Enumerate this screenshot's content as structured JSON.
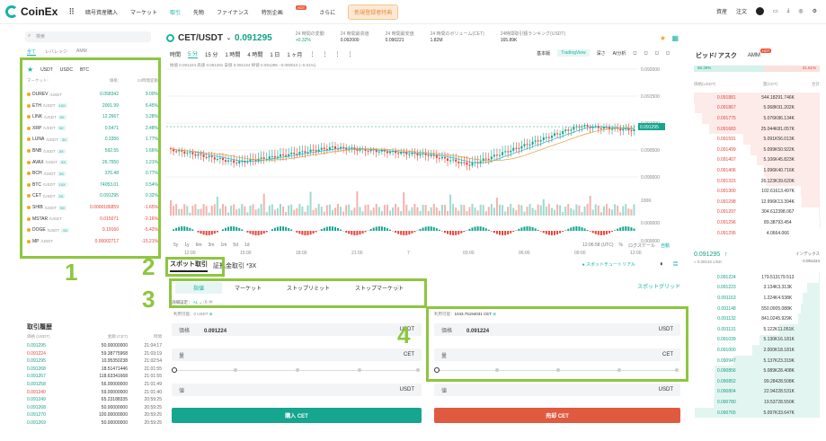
{
  "nav": {
    "logo": "CoinEx",
    "items": [
      "暗号資産購入",
      "マーケット",
      "取引",
      "先物",
      "ファイナンス",
      "特別企画",
      "さらに"
    ],
    "hot": "HOT",
    "promo": "新規登録者特典",
    "right": [
      "資産",
      "注文"
    ]
  },
  "left": {
    "search": "検索",
    "tabs": [
      "全て",
      "レバレッジ",
      "AMM"
    ],
    "quotes": [
      "USDT",
      "USDC",
      "BTC"
    ],
    "head": {
      "market": "マーケット:",
      "price": "価格:",
      "change": "24時間変動"
    },
    "rows": [
      {
        "name": "DUREV",
        "quote": "/USDT",
        "lev": "",
        "price": "0.058342",
        "chg": "9.00%",
        "up": true
      },
      {
        "name": "ETH",
        "quote": "/USDT",
        "lev": "10X",
        "price": "2001.99",
        "chg": "6.45%",
        "up": true
      },
      {
        "name": "LINK",
        "quote": "/USDT",
        "lev": "5X",
        "price": "12.2667",
        "chg": "3.28%",
        "up": true
      },
      {
        "name": "XRP",
        "quote": "/USDT",
        "lev": "5X",
        "price": "0.5471",
        "chg": "2.48%",
        "up": true
      },
      {
        "name": "LUNA",
        "quote": "/USDT",
        "lev": "3X",
        "price": "0.3356",
        "chg": "1.77%",
        "up": true
      },
      {
        "name": "BNB",
        "quote": "/USDT",
        "lev": "5X",
        "price": "592.55",
        "chg": "1.66%",
        "up": true
      },
      {
        "name": "AVAX",
        "quote": "/USDT",
        "lev": "5X",
        "price": "26.7550",
        "chg": "1.21%",
        "up": true
      },
      {
        "name": "BCH",
        "quote": "/USDT",
        "lev": "5X",
        "price": "376.48",
        "chg": "0.77%",
        "up": true
      },
      {
        "name": "BTC",
        "quote": "/USDT",
        "lev": "10X",
        "price": "74053.01",
        "chg": "0.54%",
        "up": true
      },
      {
        "name": "CET",
        "quote": "/USDT",
        "lev": "3X",
        "price": "0.091295",
        "chg": "0.32%",
        "up": true
      },
      {
        "name": "SHIB",
        "quote": "/USDT",
        "lev": "5X",
        "price": "0.0000186859",
        "chg": "-1.65%",
        "up": false
      },
      {
        "name": "MSTAR",
        "quote": "/USDT",
        "lev": "",
        "price": "0.015071",
        "chg": "-2.16%",
        "up": false
      },
      {
        "name": "DOGE",
        "quote": "/USDT",
        "lev": "5X",
        "price": "0.19160",
        "chg": "-5.42%",
        "up": false
      },
      {
        "name": "MP",
        "quote": "/USDT",
        "lev": "",
        "price": "0.00002717",
        "chg": "-15.21%",
        "up": false
      }
    ],
    "history_title": "取引履歴",
    "hist_head": [
      "価格 (USDT)",
      "金額 (CET)",
      "時間"
    ],
    "history": [
      {
        "p": "0.091295",
        "a": "50.00000000",
        "t": "21:04:17",
        "up": true
      },
      {
        "p": "0.091224",
        "a": "59.38775968",
        "t": "21:03:19",
        "up": false
      },
      {
        "p": "0.091295",
        "a": "10.95350238",
        "t": "21:02:54",
        "up": true
      },
      {
        "p": "0.091268",
        "a": "18.51471446",
        "t": "21:01:55",
        "up": true
      },
      {
        "p": "0.091267",
        "a": "118.63341668",
        "t": "21:01:55",
        "up": true
      },
      {
        "p": "0.091258",
        "a": "56.00000000",
        "t": "21:01:49",
        "up": true
      },
      {
        "p": "0.091240",
        "a": "59.00000000",
        "t": "21:01:40",
        "up": false
      },
      {
        "p": "0.091249",
        "a": "65.23188335",
        "t": "20:59:25",
        "up": true
      },
      {
        "p": "0.091268",
        "a": "50.00000000",
        "t": "20:59:25",
        "up": true
      },
      {
        "p": "0.091270",
        "a": "100.00000000",
        "t": "20:59:25",
        "up": true
      },
      {
        "p": "0.091269",
        "a": "50.00000000",
        "t": "20:59:25",
        "up": true
      }
    ]
  },
  "ticker": {
    "pair": "CET/USDT",
    "price": "0.091295",
    "stats": [
      {
        "l": "24 時間の変動",
        "v": "+0.32%"
      },
      {
        "l": "24 時間最高値",
        "v": "0.092000"
      },
      {
        "l": "24 時間最安値",
        "v": "0.090221"
      },
      {
        "l": "24 時間のボリューム(CET)",
        "v": "1.82M"
      },
      {
        "l": "24時間取引額ランキング(USDT)",
        "v": "165.89K"
      }
    ]
  },
  "chart": {
    "tools": [
      "時間",
      "5 分",
      "15 分",
      "1 時間",
      "4 時間",
      "1 日",
      "1 ヶ月"
    ],
    "right": [
      "基本版",
      "TradingView",
      "深さ",
      "AI分析"
    ],
    "ohlc": "始値 0.091224  高値 0.091291  安値 0.091224  終値 0.091285  −0.000010 (−0.01%)",
    "yticks": [
      "0.092000",
      "0.091500",
      "0.091000",
      "0.090500",
      "0.090000"
    ],
    "vticks": [
      "100K",
      "0.000000",
      "0.000000"
    ],
    "xticks": [
      "12:00",
      "15:00",
      "18:00",
      "21:00",
      "7",
      "03:00",
      "06:00",
      "09:00",
      "12:00"
    ],
    "last": "0.091295",
    "frames": [
      "5y",
      "1y",
      "6m",
      "3m",
      "1m",
      "5d",
      "1d"
    ],
    "footer": [
      "12:06:58 (UTC)",
      "%",
      "ログスケール",
      "自動"
    ]
  },
  "trade": {
    "tabs": [
      "スポット取引",
      "証拠金取引 *3X"
    ],
    "tutorial": "スポットチュートリアル",
    "order_tabs": [
      "指値",
      "マーケット",
      "ストップリミット",
      "ストップマーケット"
    ],
    "grid": "スポットグリッド",
    "setting": "詳細設定：",
    "setting_val": "AL",
    "buy": {
      "avail_label": "利用可能：",
      "avail": "0 USDT",
      "price_label": "価格",
      "price": "0.091224",
      "unit": "USDT",
      "amount_label": "量",
      "amount_unit": "CET",
      "total_label": "値",
      "total_unit": "USDT",
      "button": "購入 CET"
    },
    "sell": {
      "avail_label": "利用可能：",
      "avail": "1043.75194031 CET",
      "price_label": "価格",
      "price": "0.091224",
      "unit": "USDT",
      "amount_label": "量",
      "amount_unit": "CET",
      "total_label": "値",
      "total_unit": "USDT",
      "button": "売却 CET"
    }
  },
  "orderbook": {
    "title": "ビッド/ アスク",
    "amm": "AMM",
    "buy_pct": "68.39%",
    "sell_pct": "31.61%",
    "cols": [
      "価格(USDT)",
      "量(CET)",
      "合計"
    ],
    "asks": [
      [
        "0.091881",
        "544.182",
        "91.746K"
      ],
      [
        "0.091867",
        "5.068K",
        "91.202K"
      ],
      [
        "0.091775",
        "5.076K",
        "86.134K"
      ],
      [
        "0.091683",
        "25.044K",
        "81.057K"
      ],
      [
        "0.091591",
        "5.091K",
        "56.013K"
      ],
      [
        "0.091499",
        "5.099K",
        "50.922K"
      ],
      [
        "0.091407",
        "5.106K",
        "45.823K"
      ],
      [
        "0.091406",
        "1.096K",
        "40.716K"
      ],
      [
        "0.091315",
        "26.123K",
        "39.620K"
      ],
      [
        "0.091300",
        "102.616",
        "13.497K"
      ],
      [
        "0.091298",
        "12.996K",
        "13.394K"
      ],
      [
        "0.091297",
        "304.612",
        "398.067"
      ],
      [
        "0.091296",
        "89.387",
        "93.454"
      ],
      [
        "0.091295",
        "4.066",
        "4.066"
      ]
    ],
    "mid_price": "0.091295",
    "mid_usd": "≈ 0.09132 USD",
    "index_label": "インデックス",
    "index": "0.091224",
    "bids": [
      [
        "0.091224",
        "179.513",
        "179.513"
      ],
      [
        "0.091223",
        "3.134K",
        "3.313K"
      ],
      [
        "0.091163",
        "1.224K",
        "4.538K"
      ],
      [
        "0.091148",
        "550.000",
        "5.088K"
      ],
      [
        "0.091132",
        "841.024",
        "5.929K"
      ],
      [
        "0.091131",
        "5.122K",
        "11.051K"
      ],
      [
        "0.091039",
        "5.130K",
        "16.181K"
      ],
      [
        "0.091000",
        "2.000K",
        "18.181K"
      ],
      [
        "0.090947",
        "5.137K",
        "23.319K"
      ],
      [
        "0.090856",
        "5.089K",
        "28.408K"
      ],
      [
        "0.090852",
        "99.284",
        "28.508K"
      ],
      [
        "0.090804",
        "22.942",
        "28.531K"
      ],
      [
        "0.090780",
        "19.537",
        "28.550K"
      ],
      [
        "0.090765",
        "5.097K",
        "33.647K"
      ]
    ]
  },
  "annotations": [
    "1",
    "2",
    "3",
    "4"
  ]
}
